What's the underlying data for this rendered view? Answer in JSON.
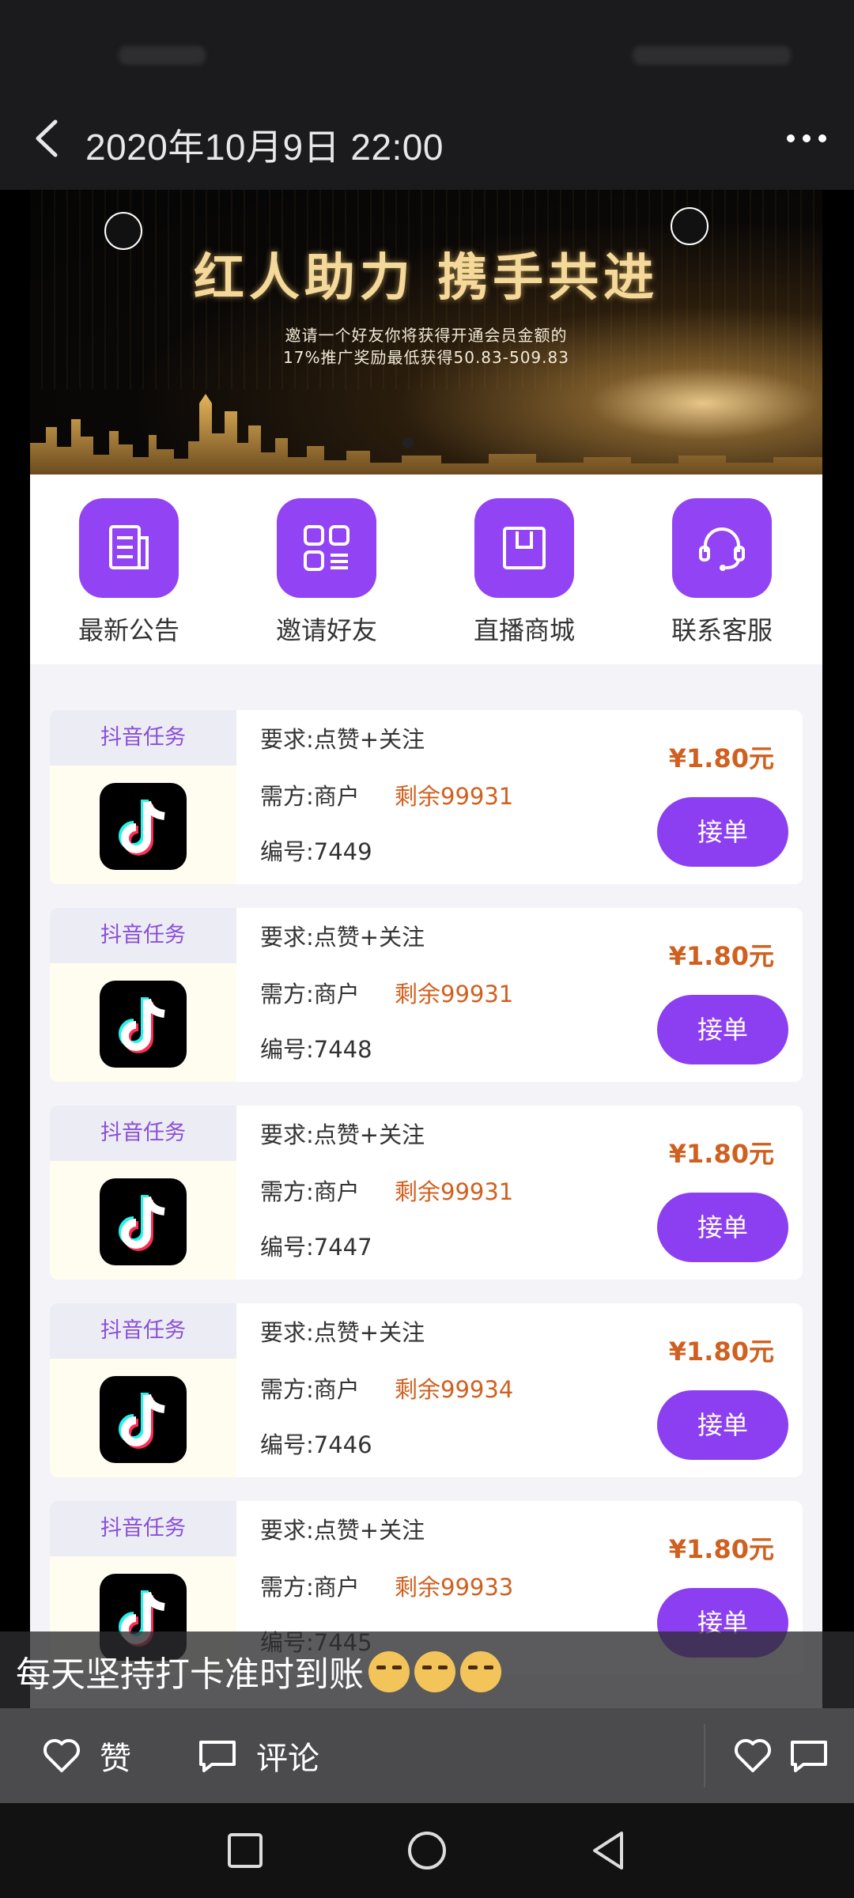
{
  "header": {
    "title": "2020年10月9日 22:00"
  },
  "banner": {
    "headline": "红人助力 携手共进",
    "line1": "邀请一个好友你将获得开通会员金额的",
    "line2": "17%推广奖励最低获得50.83-509.83"
  },
  "quick_menu": [
    {
      "label": "最新公告",
      "icon": "document-icon"
    },
    {
      "label": "邀请好友",
      "icon": "grid-list-icon"
    },
    {
      "label": "直播商城",
      "icon": "shopping-bag-icon"
    },
    {
      "label": "联系客服",
      "icon": "headset-icon"
    }
  ],
  "tasks": [
    {
      "tag": "抖音任务",
      "requirement": "要求:点赞+关注",
      "party": "需方:商户",
      "remaining": "剩余99931",
      "code": "编号:7449",
      "price": "¥1.80元",
      "button": "接单"
    },
    {
      "tag": "抖音任务",
      "requirement": "要求:点赞+关注",
      "party": "需方:商户",
      "remaining": "剩余99931",
      "code": "编号:7448",
      "price": "¥1.80元",
      "button": "接单"
    },
    {
      "tag": "抖音任务",
      "requirement": "要求:点赞+关注",
      "party": "需方:商户",
      "remaining": "剩余99931",
      "code": "编号:7447",
      "price": "¥1.80元",
      "button": "接单"
    },
    {
      "tag": "抖音任务",
      "requirement": "要求:点赞+关注",
      "party": "需方:商户",
      "remaining": "剩余99934",
      "code": "编号:7446",
      "price": "¥1.80元",
      "button": "接单"
    },
    {
      "tag": "抖音任务",
      "requirement": "要求:点赞+关注",
      "party": "需方:商户",
      "remaining": "剩余99933",
      "code": "编号:7445",
      "price": "¥1.80元",
      "button": "接单"
    }
  ],
  "caption": {
    "text": "每天坚持打卡准时到账"
  },
  "actions": {
    "like_label": "赞",
    "comment_label": "评论"
  },
  "colors": {
    "accent_purple": "#8c3ff0",
    "price_orange": "#d0601f",
    "tag_text": "#8a4fd8"
  }
}
